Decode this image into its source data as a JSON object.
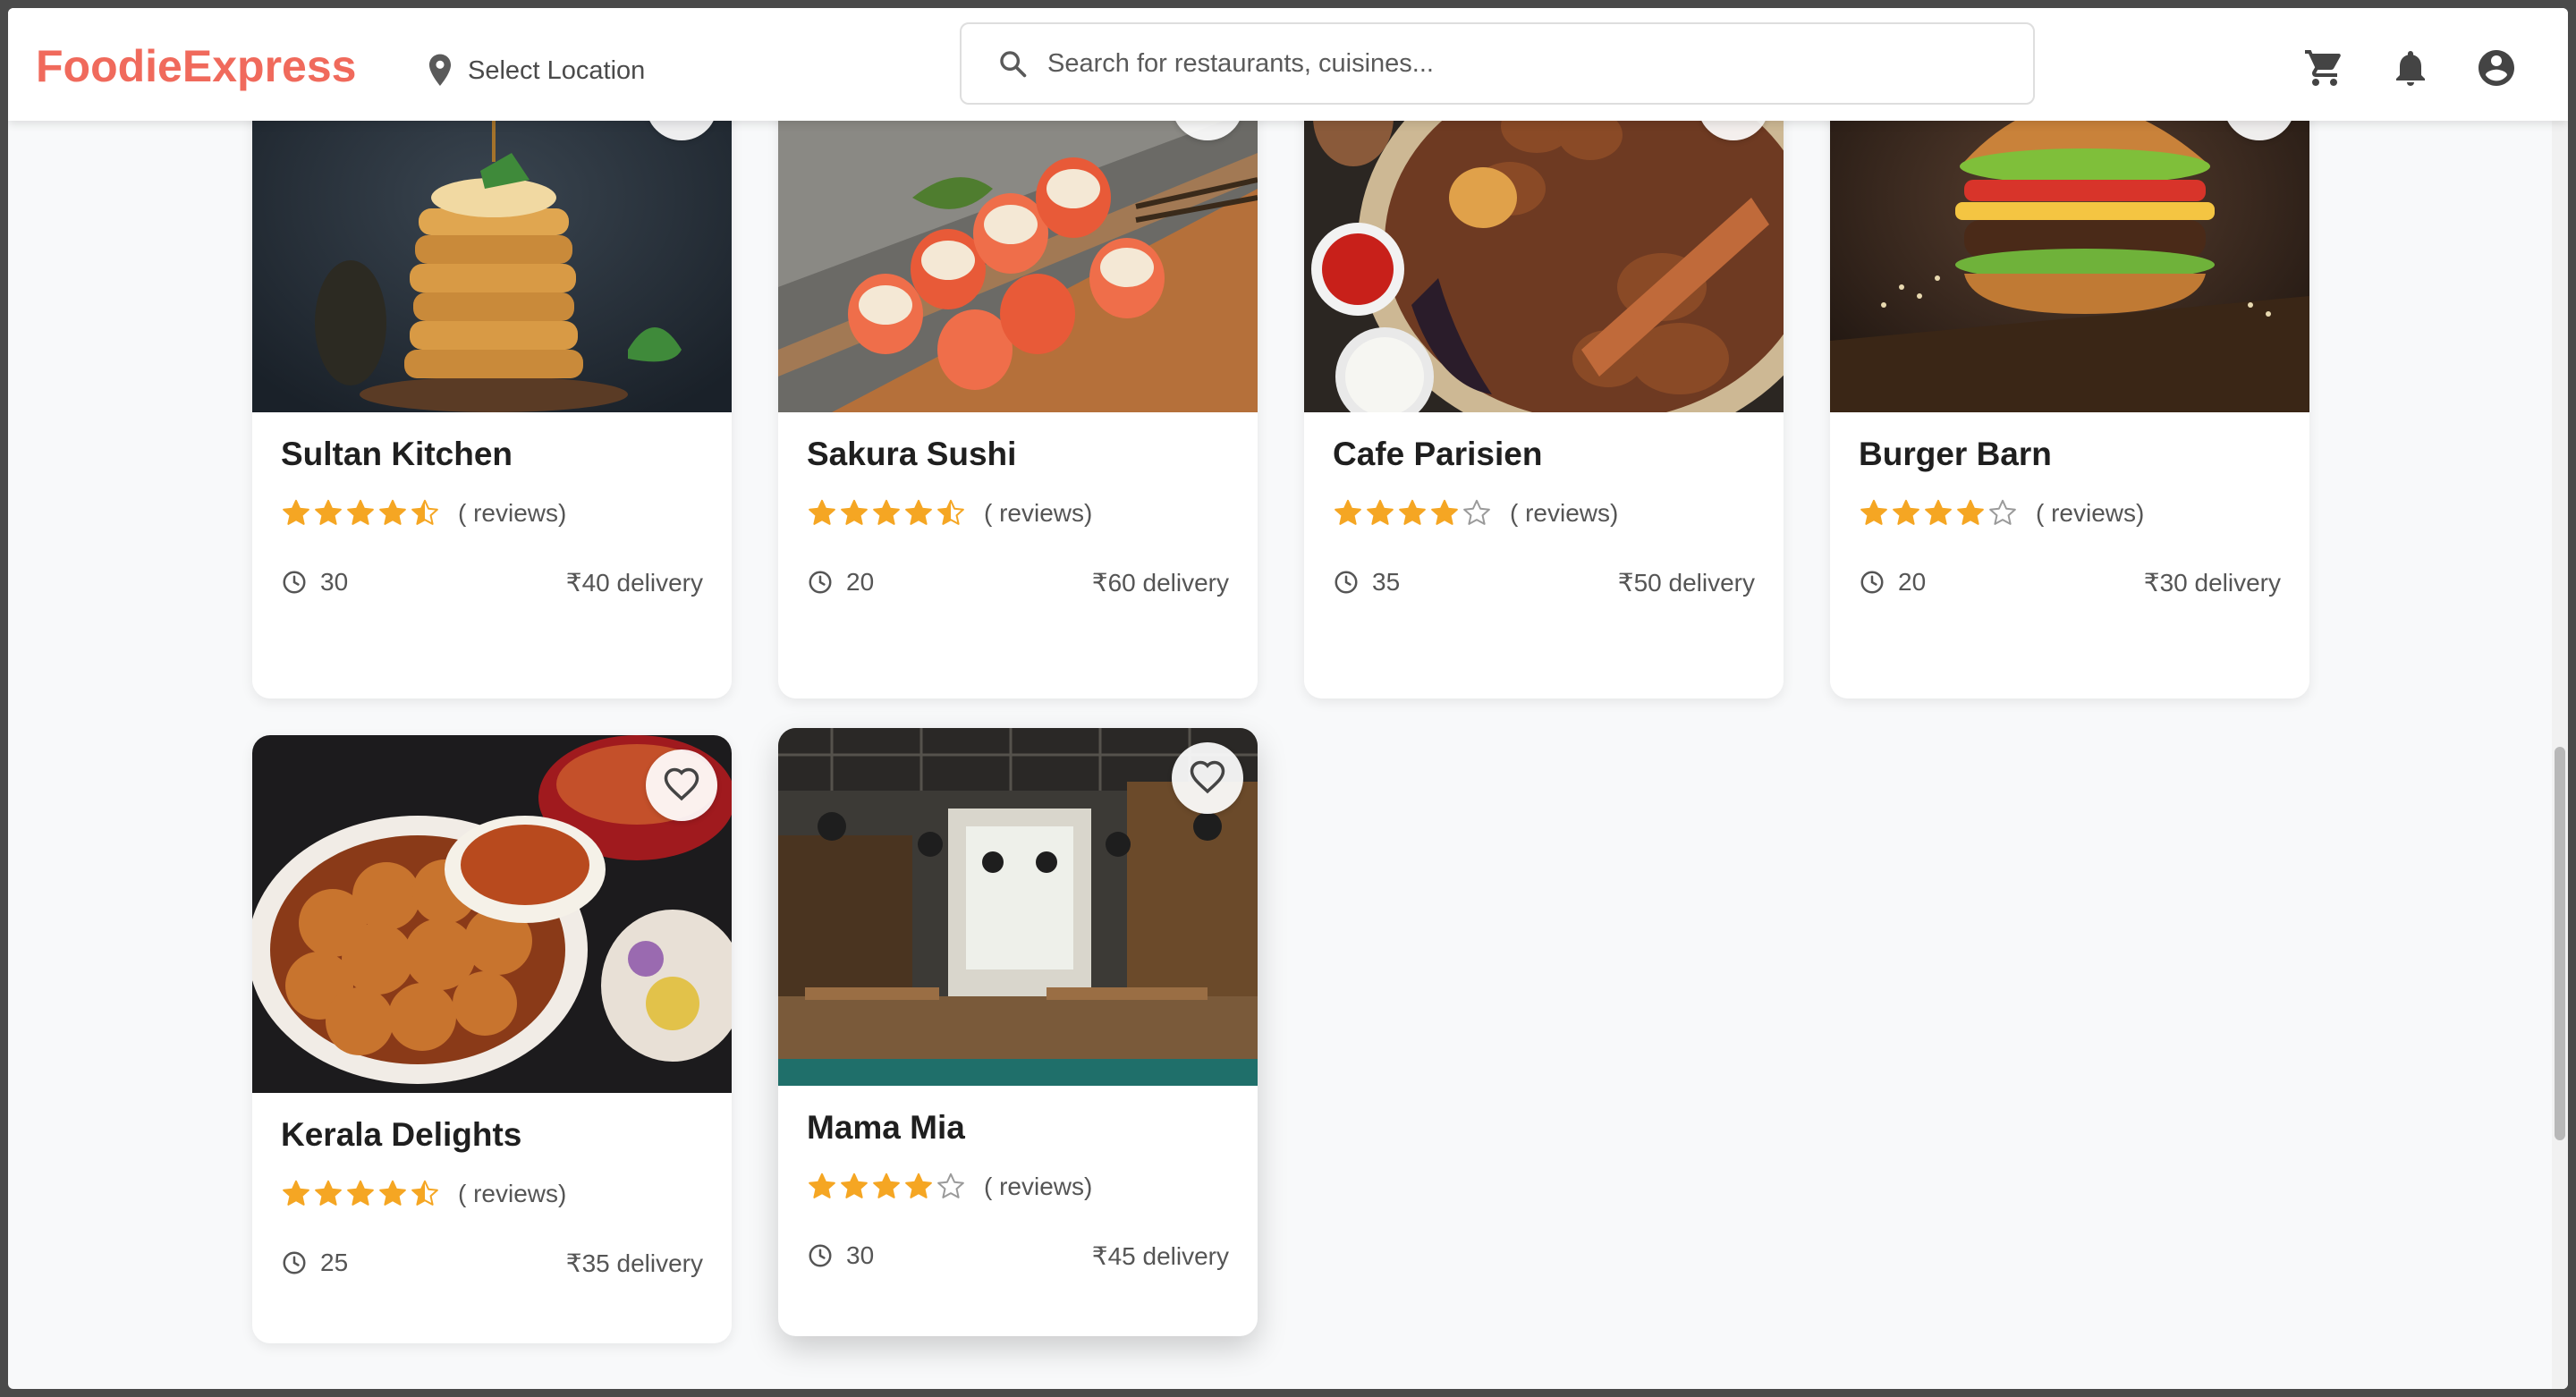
{
  "header": {
    "logo": "FoodieExpress",
    "location_label": "Select Location",
    "search_placeholder": "Search for restaurants, cuisines..."
  },
  "icons": {
    "location": "location-pin-icon",
    "search": "search-icon",
    "cart": "cart-icon",
    "notifications": "bell-icon",
    "account": "account-circle-icon",
    "favorite": "heart-outline-icon",
    "time": "clock-icon"
  },
  "colors": {
    "brand": "#f06a5c",
    "star": "#f5a623",
    "star_empty": "#9a9a9a"
  },
  "restaurants": [
    {
      "name": "Sultan Kitchen",
      "rating": 4.5,
      "reviews_label": "( reviews)",
      "time": "30",
      "delivery": "₹40 delivery"
    },
    {
      "name": "Sakura Sushi",
      "rating": 4.5,
      "reviews_label": "( reviews)",
      "time": "20",
      "delivery": "₹60 delivery"
    },
    {
      "name": "Cafe Parisien",
      "rating": 4,
      "reviews_label": "( reviews)",
      "time": "35",
      "delivery": "₹50 delivery"
    },
    {
      "name": "Burger Barn",
      "rating": 4,
      "reviews_label": "( reviews)",
      "time": "20",
      "delivery": "₹30 delivery"
    },
    {
      "name": "Kerala Delights",
      "rating": 4.5,
      "reviews_label": "( reviews)",
      "time": "25",
      "delivery": "₹35 delivery"
    },
    {
      "name": "Mama Mia",
      "rating": 4,
      "reviews_label": "( reviews)",
      "time": "30",
      "delivery": "₹45 delivery"
    }
  ]
}
